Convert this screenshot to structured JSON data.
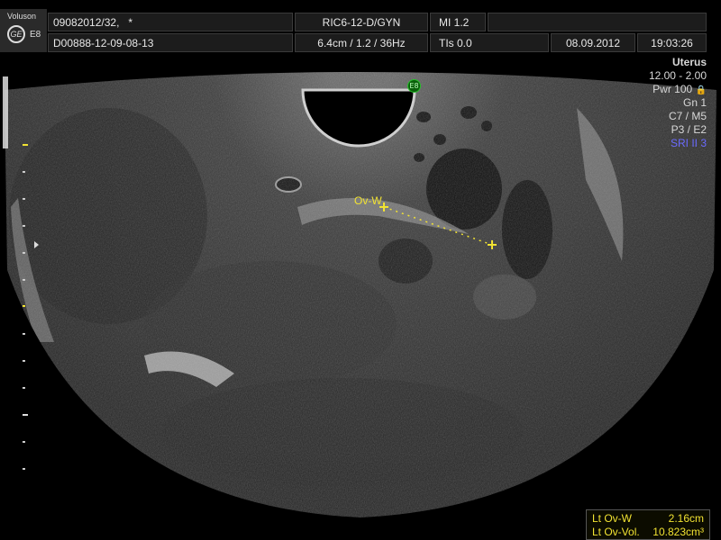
{
  "header": {
    "brand": "Voluson",
    "logo_text": "GE",
    "model": "E8",
    "patient_id": "09082012/32,",
    "patient_mark": "*",
    "exam_id": "D00888-12-09-08-13",
    "probe": "RIC6-12-D/GYN",
    "depth_info": "6.4cm / 1.2 / 36Hz",
    "mi": "MI  1.2",
    "tis": "TIs  0.0",
    "date": "08.09.2012",
    "time": "19:03:26"
  },
  "params": {
    "preset": "Uterus",
    "freq": "12.00 - 2.00",
    "power": "Pwr 100",
    "gain": "Gn  1",
    "c_m": "C7 / M5",
    "p_e": "P3 / E2",
    "sri": "SRI II 3"
  },
  "probe_marker": "E8",
  "caliper_label": "Ov-W",
  "measurements": {
    "row1_label": "Lt Ov-W",
    "row1_value": "2.16cm",
    "row2_label": "Lt Ov-Vol.",
    "row2_value": "10.823cm³"
  },
  "colors": {
    "caliper": "#f1e232",
    "marker": "#27c22b",
    "sri": "#6b6bff"
  }
}
